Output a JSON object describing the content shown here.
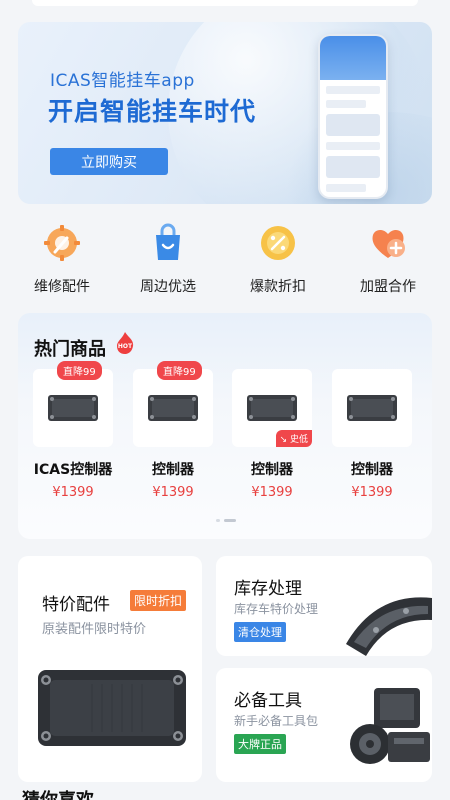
{
  "banner": {
    "subtitle": "ICAS智能挂车app",
    "title": "开启智能挂车时代",
    "button_label": "立即购买"
  },
  "categories": [
    {
      "label": "维修配件",
      "icon": "wrench-gear-icon",
      "color": "#f29a4a"
    },
    {
      "label": "周边优选",
      "icon": "shopping-bag-icon",
      "color": "#3a8ae6"
    },
    {
      "label": "爆款折扣",
      "icon": "discount-tag-icon",
      "color": "#f5b93a"
    },
    {
      "label": "加盟合作",
      "icon": "heart-plus-icon",
      "color": "#f27a4a"
    }
  ],
  "hot": {
    "title": "热门商品",
    "hot_badge": "HOT",
    "products": [
      {
        "name": "ICAS控制器",
        "price": "¥1399",
        "tag": "直降99",
        "corner_tag": ""
      },
      {
        "name": "控制器",
        "price": "¥1399",
        "tag": "直降99",
        "corner_tag": ""
      },
      {
        "name": "控制器",
        "price": "¥1399",
        "tag": "",
        "corner_tag": "史低"
      },
      {
        "name": "控制器",
        "price": "¥1399",
        "tag": "",
        "corner_tag": ""
      }
    ]
  },
  "promo_left": {
    "title": "特价配件",
    "badge": "限时折扣",
    "subtitle": "原装配件限时特价"
  },
  "promo_right_1": {
    "title": "库存处理",
    "subtitle": "库存车特价处理",
    "badge": "清仓处理"
  },
  "promo_right_2": {
    "title": "必备工具",
    "subtitle": "新手必备工具包",
    "badge": "大牌正品"
  },
  "guess_title": "猜你喜欢",
  "colors": {
    "brand_blue": "#2a72d6",
    "price_red": "#e8403f",
    "badge_orange": "#f57c39",
    "badge_blue": "#3a86e6",
    "badge_green": "#2aa553"
  }
}
